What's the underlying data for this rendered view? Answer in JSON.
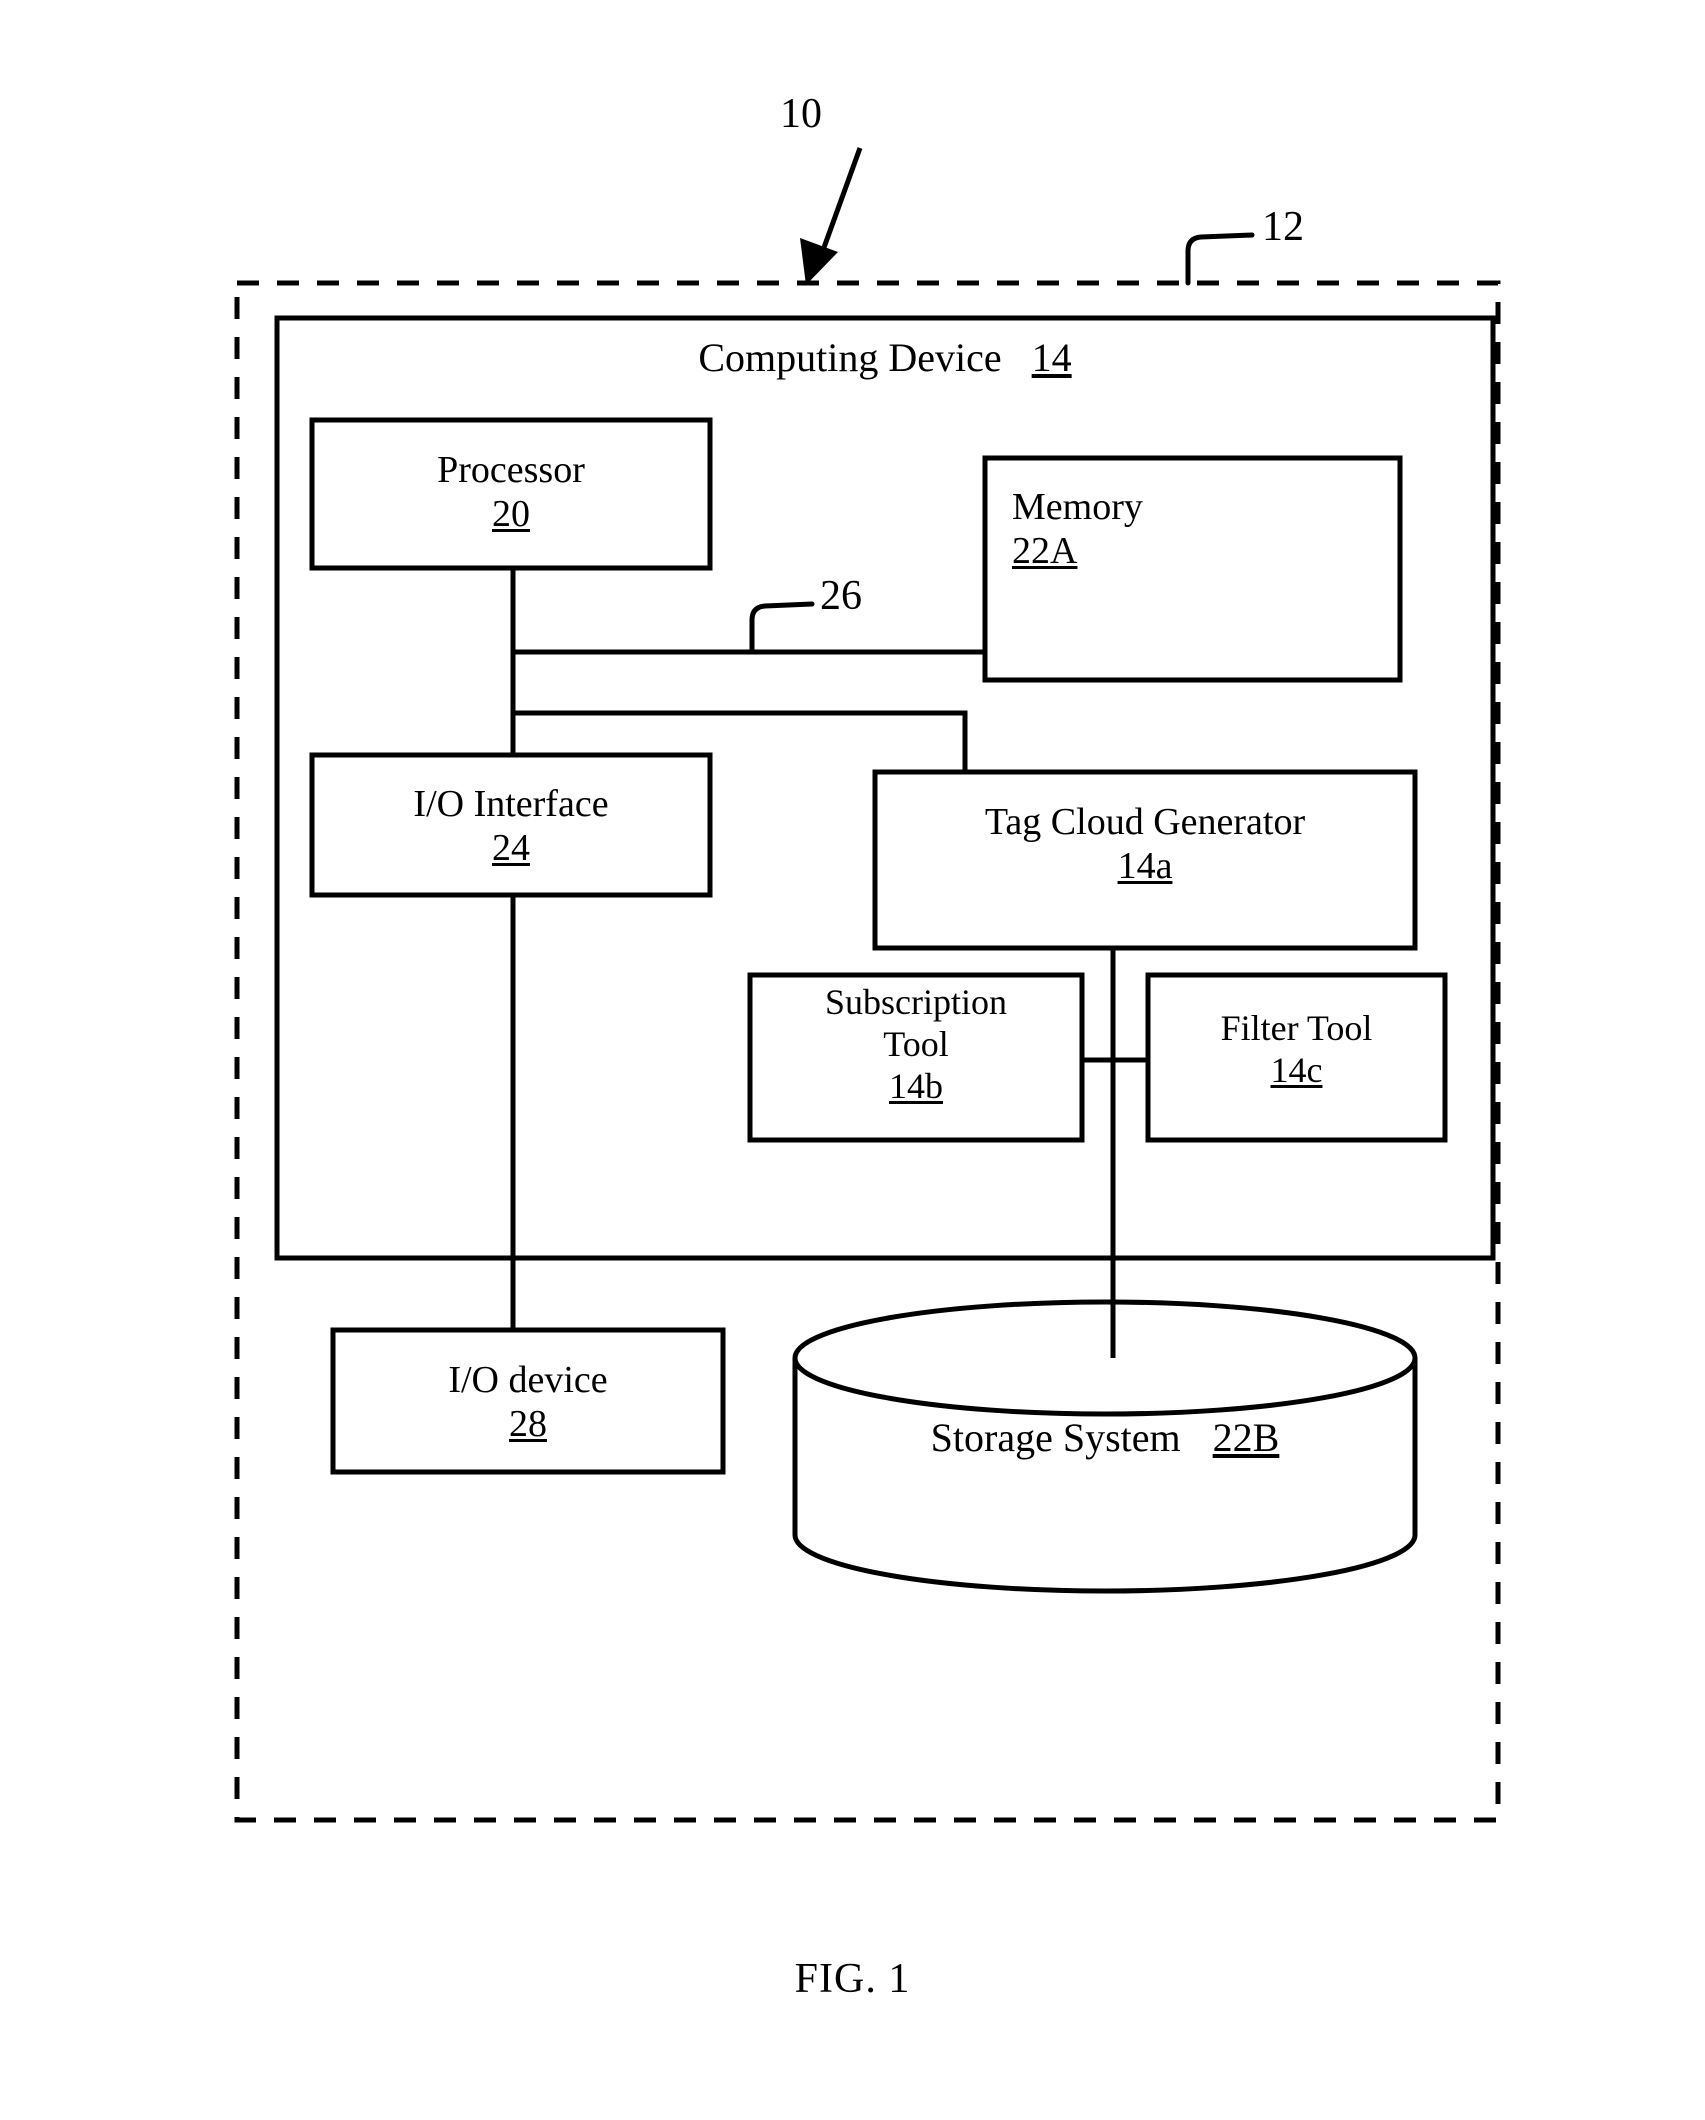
{
  "figure": {
    "caption": "FIG. 1",
    "type": "patent-block-diagram"
  },
  "reference_numerals": {
    "system": "10",
    "environment": "12",
    "bus": "26"
  },
  "outer_boundary": {
    "name": "environment-boundary",
    "style": "dashed",
    "label": "12"
  },
  "computing_device": {
    "title": "Computing Device",
    "ref": "14"
  },
  "blocks": [
    {
      "id": "processor",
      "lines": [
        "Processor"
      ],
      "ref": "20",
      "shape": "rect"
    },
    {
      "id": "memory",
      "lines": [
        "Memory"
      ],
      "ref": "22A",
      "shape": "rect"
    },
    {
      "id": "io-interface",
      "lines": [
        "I/O Interface"
      ],
      "ref": "24",
      "shape": "rect"
    },
    {
      "id": "tag-cloud-generator",
      "lines": [
        "Tag Cloud Generator"
      ],
      "ref": "14a",
      "shape": "rect"
    },
    {
      "id": "subscription-tool",
      "lines": [
        "Subscription",
        "Tool"
      ],
      "ref": "14b",
      "shape": "rect"
    },
    {
      "id": "filter-tool",
      "lines": [
        "Filter Tool"
      ],
      "ref": "14c",
      "shape": "rect"
    },
    {
      "id": "io-device",
      "lines": [
        "I/O device"
      ],
      "ref": "28",
      "shape": "rect"
    },
    {
      "id": "storage-system",
      "lines": [
        "Storage System"
      ],
      "ref": "22B",
      "shape": "cylinder"
    }
  ],
  "connectors": [
    {
      "id": "bus-to-memory",
      "label": "26",
      "from": "processor",
      "to": "memory"
    },
    {
      "id": "bus-to-tag-cloud",
      "from": "processor",
      "to": "tag-cloud-generator"
    },
    {
      "id": "processor-to-io-interface",
      "from": "processor",
      "to": "io-interface"
    },
    {
      "id": "io-interface-to-io-device",
      "from": "io-interface",
      "to": "io-device"
    },
    {
      "id": "tag-cloud-to-storage",
      "from": "tag-cloud-generator",
      "to": "storage-system"
    },
    {
      "id": "subscription-to-filter",
      "from": "subscription-tool",
      "to": "filter-tool"
    }
  ],
  "colors": {
    "ink": "#000000",
    "paper": "#ffffff"
  }
}
